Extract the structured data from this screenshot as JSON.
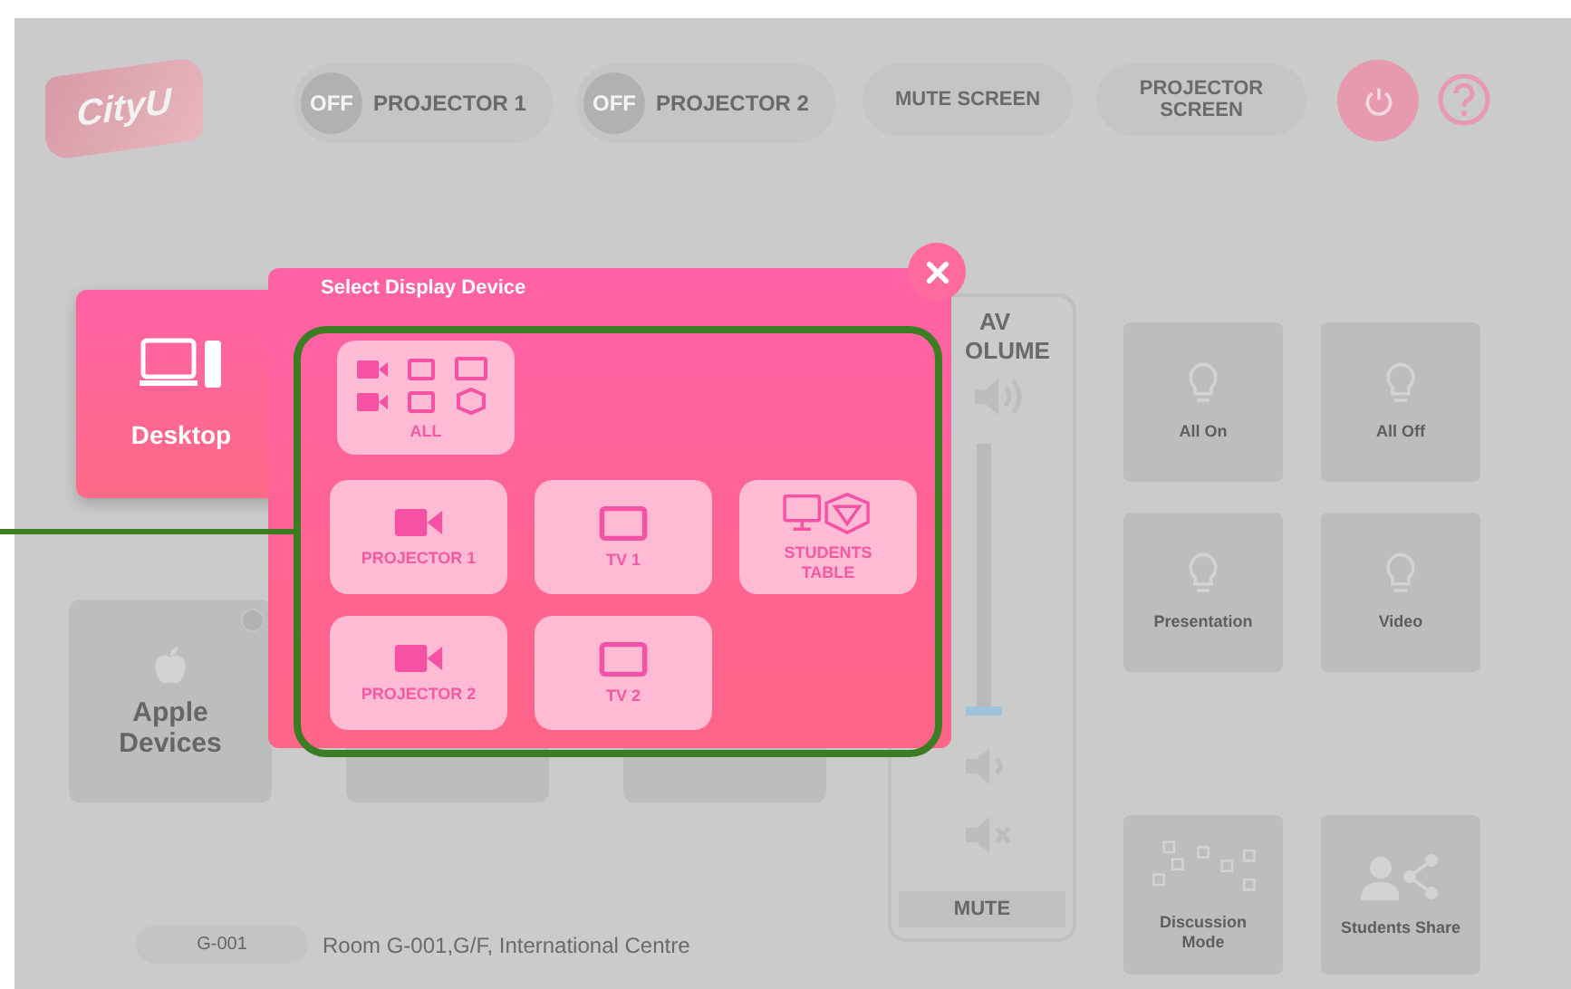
{
  "header": {
    "logo": "CityU",
    "toggles": [
      {
        "state": "OFF",
        "label": "PROJECTOR 1"
      },
      {
        "state": "OFF",
        "label": "PROJECTOR 2"
      }
    ],
    "buttons": [
      "MUTE SCREEN",
      "PROJECTOR SCREEN"
    ]
  },
  "sources": [
    {
      "kind": "desktop",
      "label": "Desktop",
      "selected": true
    },
    {
      "kind": "apple",
      "label": "Apple Devices",
      "selected": false
    },
    {
      "kind": "blank",
      "selected": false
    },
    {
      "kind": "blank",
      "selected": false
    }
  ],
  "volume": {
    "title_lines": [
      "AV",
      "OLUME"
    ],
    "level": 0,
    "mute_label": "MUTE"
  },
  "scenes": [
    {
      "kind": "bulb",
      "label": "All On"
    },
    {
      "kind": "bulb",
      "label": "All Off"
    },
    {
      "kind": "bulb",
      "label": "Presentation"
    },
    {
      "kind": "bulb",
      "label": "Video"
    },
    {
      "kind": "discussion",
      "label": "Discussion Mode"
    },
    {
      "kind": "share",
      "label": "Students Share"
    }
  ],
  "footer": {
    "room_code": "G-001",
    "room_name": "Room G-001,G/F, International Centre"
  },
  "dialog": {
    "title": "Select Display Device",
    "devices": [
      {
        "kind": "all",
        "label": "ALL"
      },
      {
        "kind": "projector",
        "label": "PROJECTOR 1"
      },
      {
        "kind": "tv",
        "label": "TV 1"
      },
      {
        "kind": "table",
        "label": "STUDENTS TABLE"
      },
      {
        "kind": "projector",
        "label": "PROJECTOR 2"
      },
      {
        "kind": "tv",
        "label": "TV 2"
      }
    ]
  }
}
